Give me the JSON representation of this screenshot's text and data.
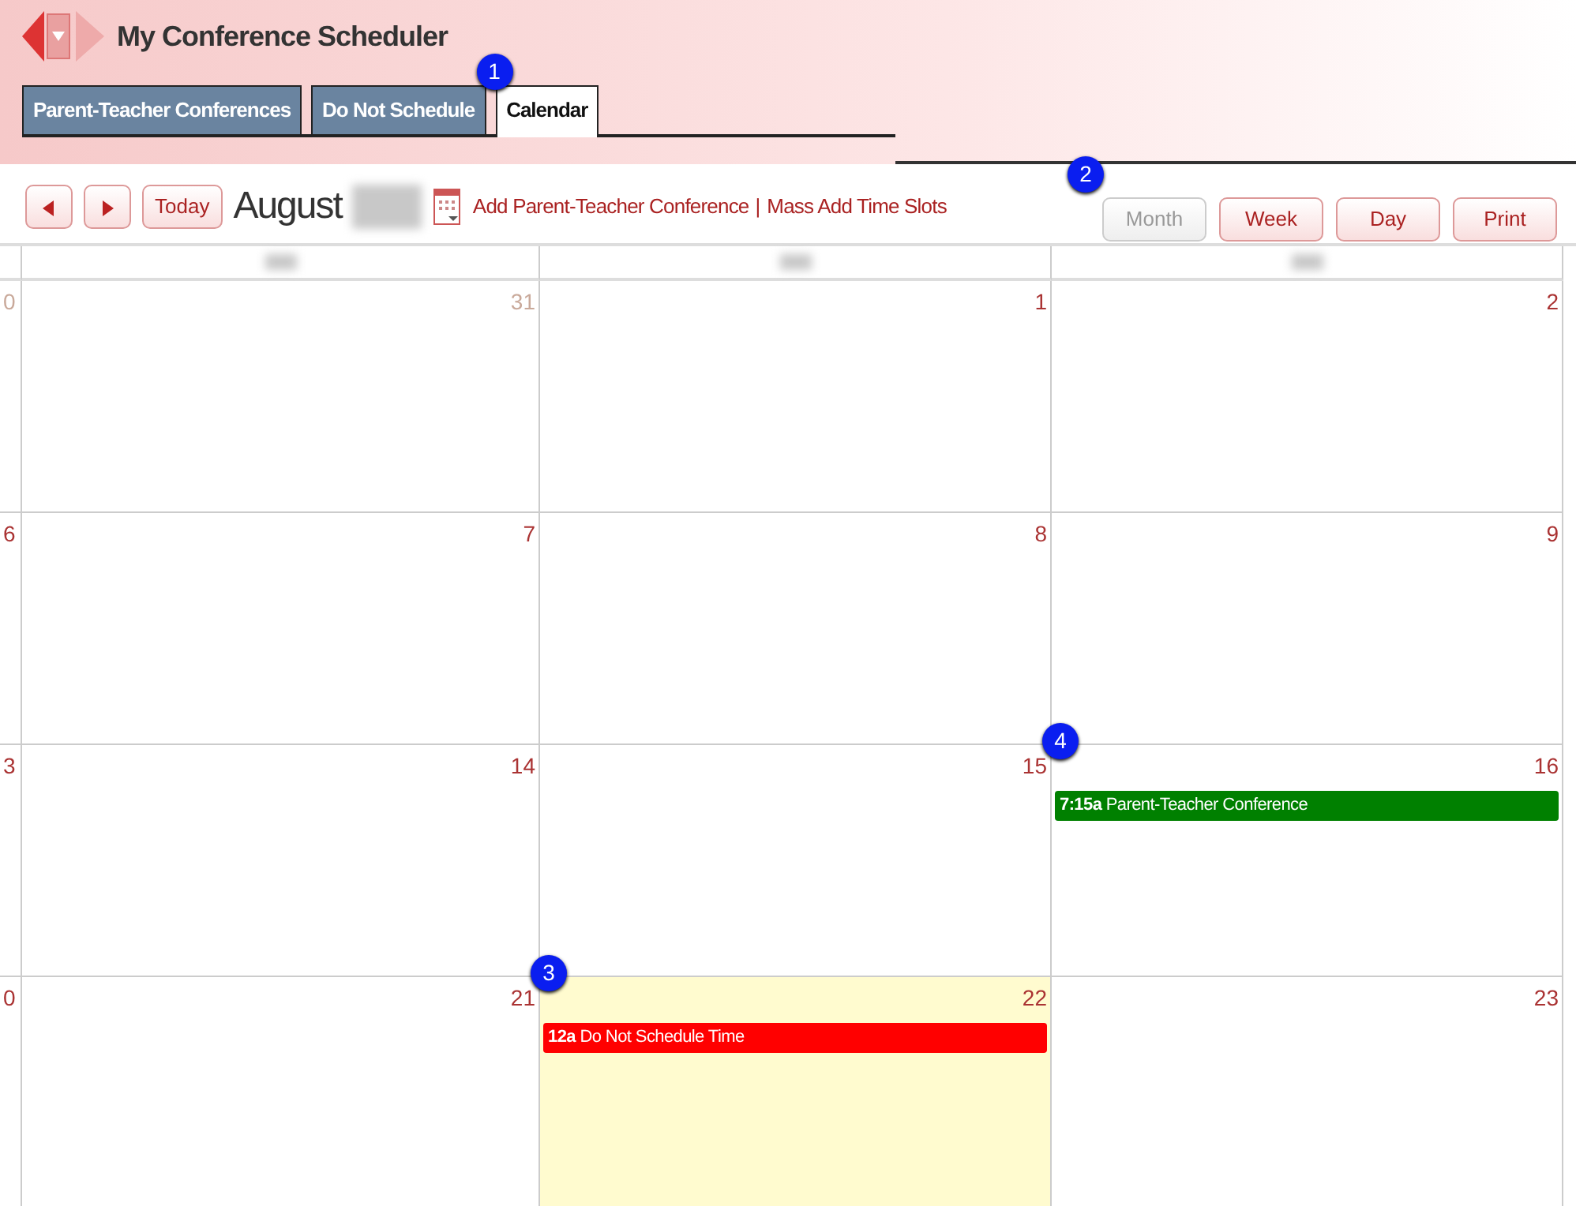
{
  "app": {
    "title": "My Conference Scheduler"
  },
  "tabs": [
    {
      "label": "Parent-Teacher Conferences",
      "selected": false
    },
    {
      "label": "Do Not Schedule",
      "selected": false
    },
    {
      "label": "Calendar",
      "selected": true,
      "callout": "1"
    }
  ],
  "toolbar": {
    "today": "Today",
    "month": "August",
    "links": [
      "Add Parent-Teacher Conference",
      "Mass Add Time Slots"
    ],
    "separator": "|"
  },
  "view_buttons": {
    "callout": "2",
    "items": [
      {
        "label": "Month",
        "disabled": true
      },
      {
        "label": "Week",
        "disabled": false
      },
      {
        "label": "Day",
        "disabled": false
      },
      {
        "label": "Print",
        "disabled": false
      }
    ]
  },
  "calendar": {
    "weeks": [
      {
        "days": [
          {
            "date": "0",
            "other_month": true
          },
          {
            "date": "31",
            "other_month": true
          },
          {
            "date": "1",
            "other_month": false
          },
          {
            "date": "2",
            "other_month": false
          }
        ]
      },
      {
        "days": [
          {
            "date": "6",
            "other_month": false
          },
          {
            "date": "7",
            "other_month": false
          },
          {
            "date": "8",
            "other_month": false
          },
          {
            "date": "9",
            "other_month": false
          }
        ]
      },
      {
        "days": [
          {
            "date": "3",
            "other_month": false
          },
          {
            "date": "14",
            "other_month": false
          },
          {
            "date": "15",
            "other_month": false
          },
          {
            "date": "16",
            "other_month": false,
            "callout": "4",
            "events": [
              {
                "text": "**7:15a** Parent-Teacher Conference",
                "color": "#008000"
              }
            ]
          }
        ]
      },
      {
        "days": [
          {
            "date": "0",
            "other_month": false
          },
          {
            "date": "21",
            "other_month": false
          },
          {
            "date": "22",
            "other_month": false,
            "today": true,
            "callout": "3",
            "events": [
              {
                "text": "**12a** Do Not Schedule Time",
                "color": "#ff0000"
              }
            ]
          },
          {
            "date": "23",
            "other_month": false
          }
        ]
      }
    ]
  }
}
